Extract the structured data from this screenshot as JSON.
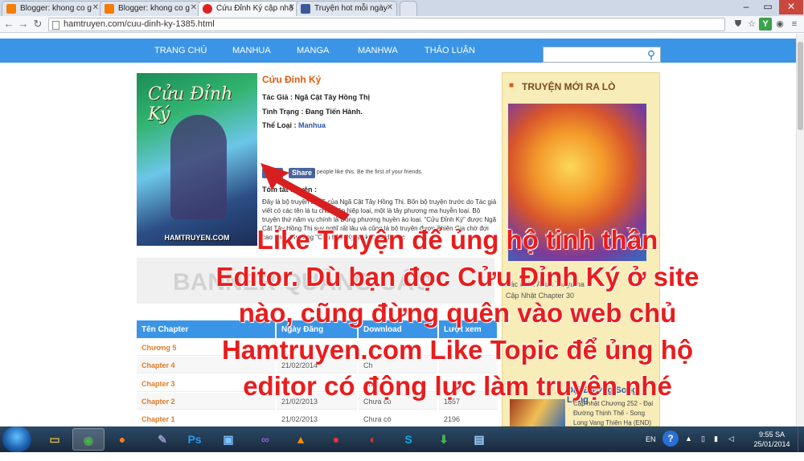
{
  "browser": {
    "tabs": [
      {
        "label": "Blogger: khong co g",
        "active": false,
        "icon_color": "#f57d00",
        "icon": "blogger-icon"
      },
      {
        "label": "Blogger: khong co g",
        "active": false,
        "icon_color": "#f57d00",
        "icon": "blogger-icon"
      },
      {
        "label": "Cứu Đỉnh Ký cập nhậ",
        "active": true,
        "icon_color": "#e02020",
        "icon": "hamtruyen-icon"
      },
      {
        "label": "Truyện hot mỗi ngày",
        "active": false,
        "icon_color": "#3b5998",
        "icon": "facebook-icon"
      }
    ],
    "url": "hamtruyen.com/cuu-dinh-ky-1385.html",
    "extension_label": "Y"
  },
  "site": {
    "nav": [
      "TRANG CHỦ",
      "MANHUA",
      "MANGA",
      "MANHWA",
      "THẢO LUẬN"
    ],
    "search_placeholder": ""
  },
  "manga": {
    "title": "Cứu Đỉnh Ký",
    "cover_title": "Cửu Đỉnh Ký",
    "cover_site": "HAMTRUYEN.COM",
    "author_label": "Tác Giả :",
    "author": "Ngã Cật Tây Hồng Thị",
    "status_label": "Tình Trạng :",
    "status": "Đang Tiến Hành.",
    "genre_label": "Thể Loại :",
    "genre": "Manhua",
    "fb_like": "Like",
    "fb_share": "Share",
    "fb_text": "2 people like this. Be the first of your friends.",
    "summary_label": "Tóm tắt truyện :",
    "summary": "Đây là bộ truyện thứ 5 của Ngã Cật Tây Hồng Thị. Bốn bộ truyện trước do Tác giả viết có các tên lá tu chân tiên hiệp loại, một là tây phương ma huyễn loại. Bộ truyện thứ năm vụ chính là Đông phương huyền ảo loại. \"Cửu Đỉnh Ký\" được Ngã Cật Tây Hồng Thị suy nghĩ rất lâu và cũng là bộ truyện được Phiên Gia chờ đợi cao nhất. Tin rằng \"Cửu Đỉnh Ký\"sẽ không khiến c"
  },
  "banner": {
    "text": "BANNER QUẢNG CÁO"
  },
  "chapters": {
    "headers": [
      "Tên Chapter",
      "Ngày Đăng",
      "Download",
      "Lượt xem"
    ],
    "rows": [
      {
        "name": "Chương 5",
        "date": "",
        "download": "",
        "views": ""
      },
      {
        "name": "Chapter 4",
        "date": "21/02/2014",
        "download": "Ch",
        "views": ""
      },
      {
        "name": "Chapter 3",
        "date": "",
        "download": "Ch",
        "views": ""
      },
      {
        "name": "Chapter 2",
        "date": "21/02/2013",
        "download": "Chưa có",
        "views": "1857"
      },
      {
        "name": "Chapter 1",
        "date": "21/02/2013",
        "download": "Chưa có",
        "views": "2196"
      }
    ]
  },
  "sidebar": {
    "heading": "TRUYỆN MỚI RA LÒ",
    "new_manga_author": "Tác Giả : Akira Toriyama",
    "new_manga_chapter": "Cập Nhật Chapter 30",
    "dragon_title": "Đại Đường Song Long",
    "dragon_update": "Cập nhật Chương 252 - Đại Đường Thịnh Thế - Song Long Vang Thiên Hạ (END)"
  },
  "overlay_text": [
    "Like Truyện để ủng hộ tinh thần",
    "Editor. Dù bạn đọc Cửu Đỉnh Ký ở site",
    "nào, cũng đừng quên vào web chủ",
    "Hamtruyen.com Like Topic để ủng hộ",
    "editor có động lực làm truyện nhé"
  ],
  "taskbar": {
    "apps": [
      {
        "name": "explorer",
        "glyph": "▭",
        "color": "#e0b64a"
      },
      {
        "name": "chrome",
        "glyph": "◉",
        "color": "#4caf50"
      },
      {
        "name": "firefox",
        "glyph": "●",
        "color": "#ff7a1a"
      },
      {
        "name": "tool",
        "glyph": "✎",
        "color": "#88c"
      },
      {
        "name": "photoshop",
        "glyph": "Ps",
        "color": "#2a9ae8"
      },
      {
        "name": "app",
        "glyph": "▣",
        "color": "#7fc2ff"
      },
      {
        "name": "visual-studio",
        "glyph": "∞",
        "color": "#8f5cd1"
      },
      {
        "name": "vlc",
        "glyph": "▲",
        "color": "#ff8c00"
      },
      {
        "name": "media",
        "glyph": "●",
        "color": "#e33"
      },
      {
        "name": "skype",
        "glyph": "S",
        "color": "#00aff0"
      },
      {
        "name": "download-manager",
        "glyph": "⬇",
        "color": "#4caf50"
      },
      {
        "name": "remote-desktop",
        "glyph": "▤",
        "color": "#9cf"
      }
    ],
    "lang": "EN",
    "time": "9:55 SA",
    "date": "25/01/2014"
  }
}
